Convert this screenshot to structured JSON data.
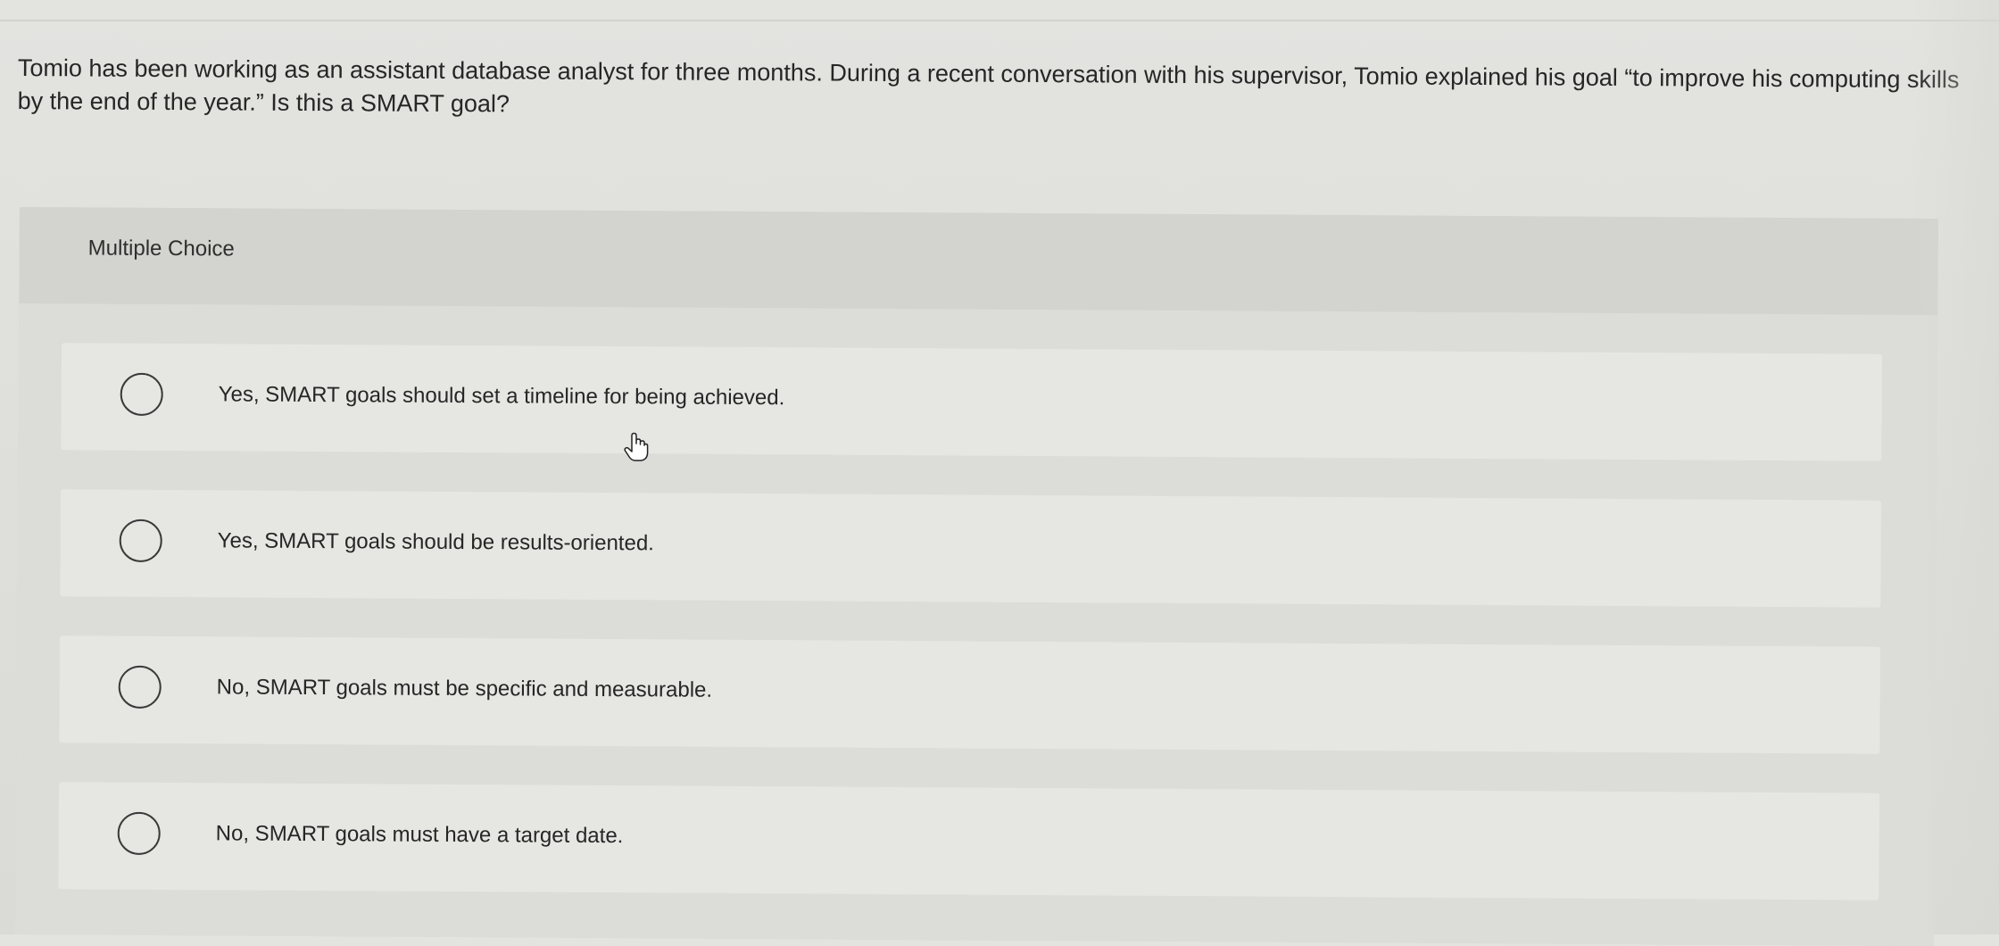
{
  "question": {
    "text": "Tomio has been working as an assistant database analyst for three months. During a recent conversation with his supervisor, Tomio explained his goal “to improve his computing skills by the end of the year.” Is this a SMART goal?"
  },
  "multiple_choice": {
    "label": "Multiple Choice",
    "options": [
      {
        "label": "Yes, SMART goals should set a timeline for being achieved.",
        "selected": false
      },
      {
        "label": "Yes, SMART goals should be results-oriented.",
        "selected": false
      },
      {
        "label": "No, SMART goals must be specific and measurable.",
        "selected": false
      },
      {
        "label": "No, SMART goals must have a target date.",
        "selected": false
      }
    ]
  },
  "cursor": {
    "icon": "hand-pointer-icon"
  }
}
